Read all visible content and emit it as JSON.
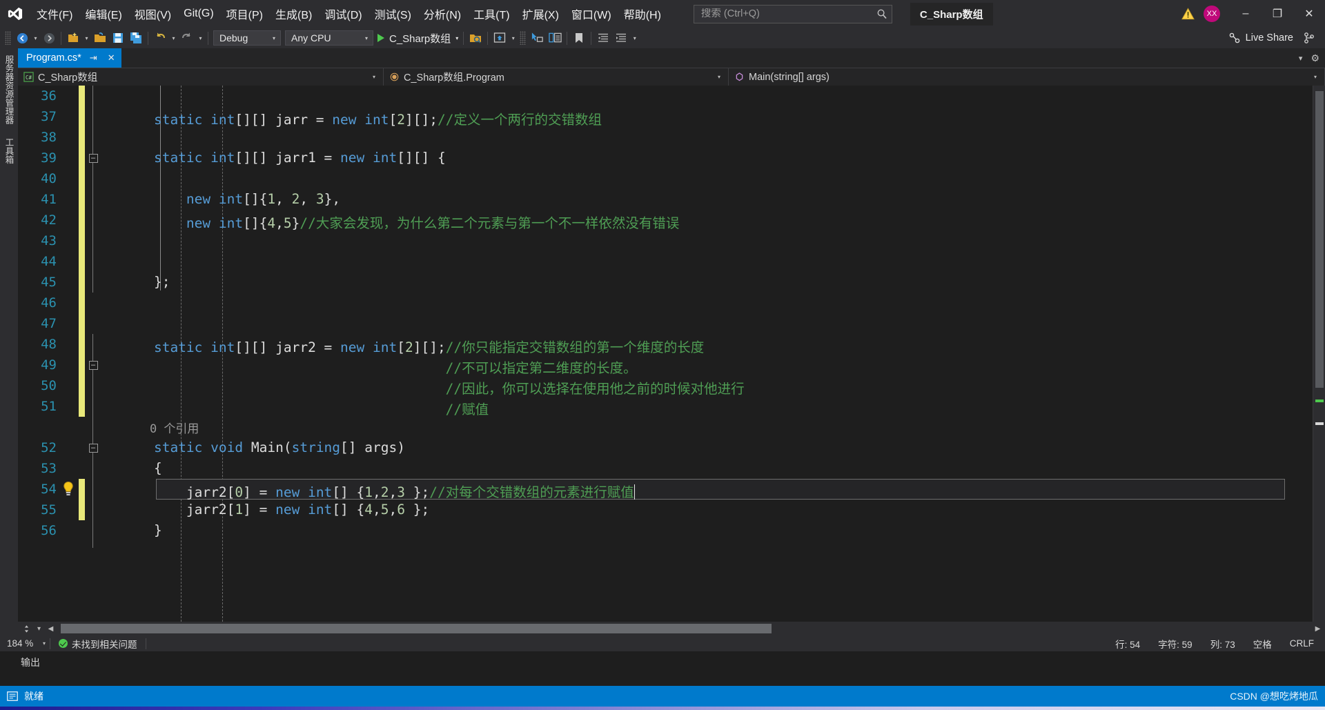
{
  "titlebar": {
    "logo": "visual-studio-logo",
    "menus": [
      {
        "label": "文件(F)",
        "key": "F"
      },
      {
        "label": "编辑(E)",
        "key": "E"
      },
      {
        "label": "视图(V)",
        "key": "V"
      },
      {
        "label": "Git(G)",
        "key": "G"
      },
      {
        "label": "项目(P)",
        "key": "P"
      },
      {
        "label": "生成(B)",
        "key": "B"
      },
      {
        "label": "调试(D)",
        "key": "D"
      },
      {
        "label": "测试(S)",
        "key": "S"
      },
      {
        "label": "分析(N)",
        "key": "N"
      },
      {
        "label": "工具(T)",
        "key": "T"
      },
      {
        "label": "扩展(X)",
        "key": "X"
      },
      {
        "label": "窗口(W)",
        "key": "W"
      },
      {
        "label": "帮助(H)",
        "key": "H"
      }
    ],
    "search_placeholder": "搜索 (Ctrl+Q)",
    "project_title": "C_Sharp数组",
    "avatar_initials": "XX",
    "minimize": "–",
    "restore": "❐",
    "close": "✕"
  },
  "toolbar": {
    "config": "Debug",
    "platform": "Any CPU",
    "run_target": "C_Sharp数组",
    "live_share": "Live Share"
  },
  "tabs": [
    {
      "label": "Program.cs*",
      "modified": true,
      "active": true
    }
  ],
  "navbar": {
    "project": "C_Sharp数组",
    "type": "C_Sharp数组.Program",
    "member": "Main(string[] args)"
  },
  "editor": {
    "first_line": 36,
    "current_line": 54,
    "lines": [
      {
        "n": 36,
        "text": "",
        "modified": true
      },
      {
        "n": 37,
        "text": "    static int[][] jarr = new int[2][];//定义一个两行的交错数组",
        "modified": true
      },
      {
        "n": 38,
        "text": "",
        "modified": true
      },
      {
        "n": 39,
        "text": "    static int[][] jarr1 = new int[][] {",
        "modified": true,
        "fold": "collapse"
      },
      {
        "n": 40,
        "text": "",
        "modified": true
      },
      {
        "n": 41,
        "text": "        new int[]{1, 2, 3},",
        "modified": true
      },
      {
        "n": 42,
        "text": "        new int[]{4,5}//大家会发现，为什么第二个元素与第一个不一样依然没有错误",
        "modified": true
      },
      {
        "n": 43,
        "text": "",
        "modified": true
      },
      {
        "n": 44,
        "text": "",
        "modified": true
      },
      {
        "n": 45,
        "text": "    };",
        "modified": true
      },
      {
        "n": 46,
        "text": "",
        "modified": true
      },
      {
        "n": 47,
        "text": "",
        "modified": true
      },
      {
        "n": 48,
        "text": "    static int[][] jarr2 = new int[2][];//你只能指定交错数组的第一个维度的长度",
        "modified": true
      },
      {
        "n": 49,
        "text": "                                        //不可以指定第二维度的长度。",
        "modified": true,
        "fold": "collapse"
      },
      {
        "n": 50,
        "text": "                                        //因此，你可以选择在使用他之前的时候对他进行",
        "modified": true
      },
      {
        "n": 51,
        "text": "                                        //赋值",
        "modified": true
      },
      {
        "n": null,
        "text": "    0 个引用",
        "codelens": true
      },
      {
        "n": 52,
        "text": "    static void Main(string[] args)",
        "fold": "collapse"
      },
      {
        "n": 53,
        "text": "    {"
      },
      {
        "n": 54,
        "text": "        jarr2[0] = new int[] {1,2,3 };//对每个交错数组的元素进行赋值",
        "current": true,
        "bulb": true,
        "modified": true
      },
      {
        "n": 55,
        "text": "        jarr2[1] = new int[] {4,5,6 };",
        "modified": true
      },
      {
        "n": 56,
        "text": "    }"
      }
    ],
    "codelens_label": "0 个引用"
  },
  "zoombar": {
    "zoom": "184 %",
    "issues": "未找到相关问题"
  },
  "output": {
    "label": "输出"
  },
  "statusbar": {
    "ready": "就绪",
    "line": "行: 54",
    "char": "字符: 59",
    "col": "列: 73",
    "spaces": "空格",
    "eol": "CRLF",
    "watermark": "CSDN @想吃烤地瓜"
  },
  "colors": {
    "accent": "#007acc",
    "keyword": "#569cd6",
    "comment": "#4f9e54",
    "number": "#b5cea8",
    "linenum": "#2b91af",
    "modified_bar": "#e8e87a",
    "avatar": "#c0097a"
  }
}
